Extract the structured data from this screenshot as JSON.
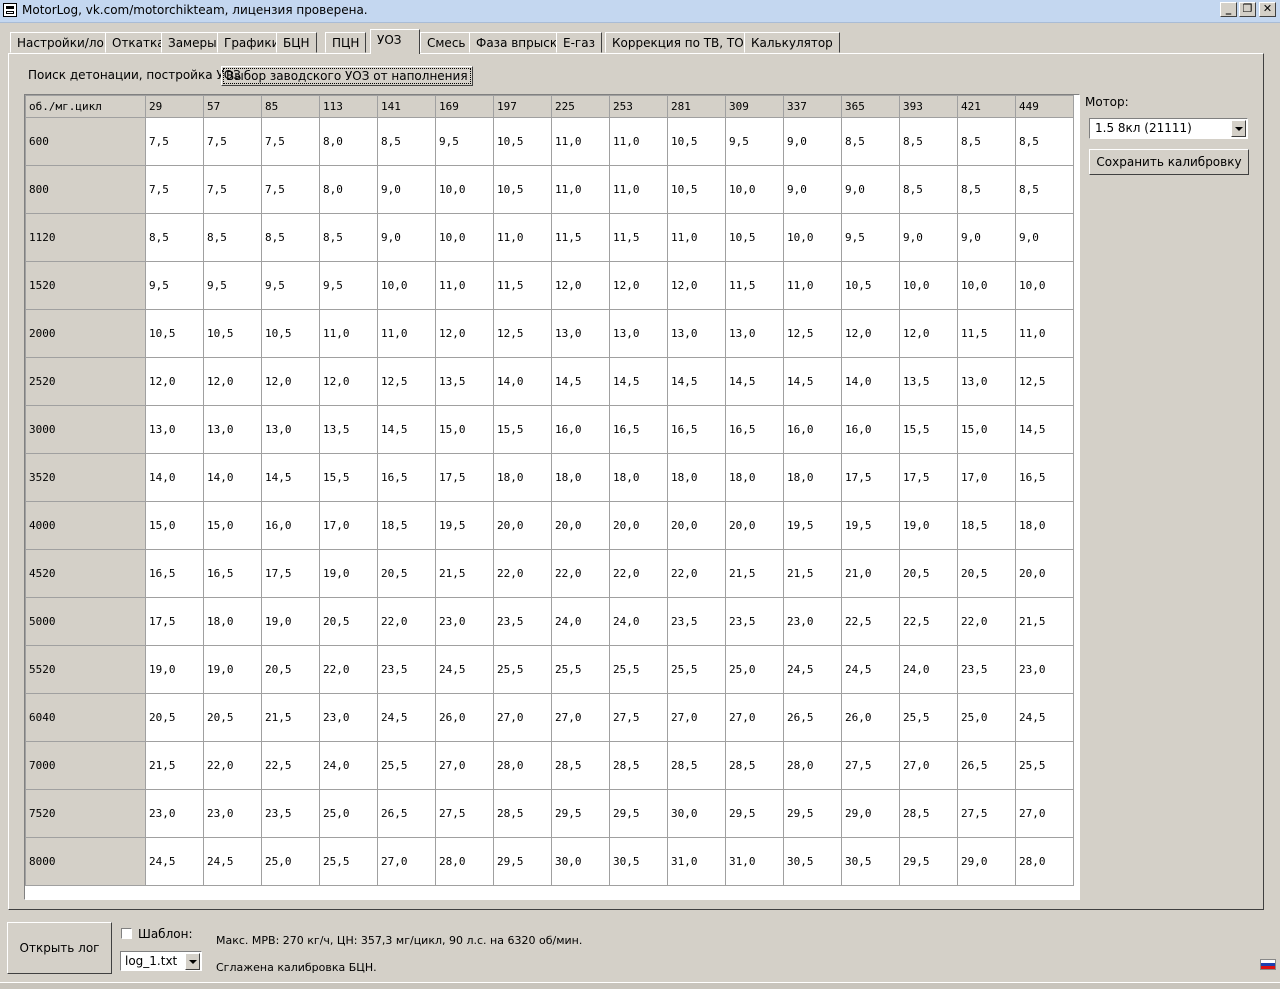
{
  "window": {
    "title": "MotorLog, vk.com/motorchikteam, лицензия проверена."
  },
  "tabs": [
    {
      "label": "Настройки/лог"
    },
    {
      "label": "Откатка"
    },
    {
      "label": "Замеры"
    },
    {
      "label": "Графики"
    },
    {
      "label": "БЦН"
    },
    {
      "label": "ПЦН"
    },
    {
      "label": "УОЗ"
    },
    {
      "label": "Смесь"
    },
    {
      "label": "Фаза впрыска"
    },
    {
      "label": "E-газ"
    },
    {
      "label": "Коррекция по ТВ, ТОЖ"
    },
    {
      "label": "Калькулятор"
    }
  ],
  "active_tab": "УОЗ",
  "subtabs": [
    {
      "label": "Поиск детонации, постройка УОЗ"
    },
    {
      "label": "Выбор заводского УОЗ от наполнения"
    }
  ],
  "active_subtab": "Выбор заводского УОЗ от наполнения",
  "grid": {
    "corner": "об./мг.цикл",
    "columns": [
      "29",
      "57",
      "85",
      "113",
      "141",
      "169",
      "197",
      "225",
      "253",
      "281",
      "309",
      "337",
      "365",
      "393",
      "421",
      "449"
    ],
    "rows": [
      {
        "rpm": "600",
        "values": [
          "7,5",
          "7,5",
          "7,5",
          "8,0",
          "8,5",
          "9,5",
          "10,5",
          "11,0",
          "11,0",
          "10,5",
          "9,5",
          "9,0",
          "8,5",
          "8,5",
          "8,5",
          "8,5"
        ]
      },
      {
        "rpm": "800",
        "values": [
          "7,5",
          "7,5",
          "7,5",
          "8,0",
          "9,0",
          "10,0",
          "10,5",
          "11,0",
          "11,0",
          "10,5",
          "10,0",
          "9,0",
          "9,0",
          "8,5",
          "8,5",
          "8,5"
        ]
      },
      {
        "rpm": "1120",
        "values": [
          "8,5",
          "8,5",
          "8,5",
          "8,5",
          "9,0",
          "10,0",
          "11,0",
          "11,5",
          "11,5",
          "11,0",
          "10,5",
          "10,0",
          "9,5",
          "9,0",
          "9,0",
          "9,0"
        ]
      },
      {
        "rpm": "1520",
        "values": [
          "9,5",
          "9,5",
          "9,5",
          "9,5",
          "10,0",
          "11,0",
          "11,5",
          "12,0",
          "12,0",
          "12,0",
          "11,5",
          "11,0",
          "10,5",
          "10,0",
          "10,0",
          "10,0"
        ]
      },
      {
        "rpm": "2000",
        "values": [
          "10,5",
          "10,5",
          "10,5",
          "11,0",
          "11,0",
          "12,0",
          "12,5",
          "13,0",
          "13,0",
          "13,0",
          "13,0",
          "12,5",
          "12,0",
          "12,0",
          "11,5",
          "11,0"
        ]
      },
      {
        "rpm": "2520",
        "values": [
          "12,0",
          "12,0",
          "12,0",
          "12,0",
          "12,5",
          "13,5",
          "14,0",
          "14,5",
          "14,5",
          "14,5",
          "14,5",
          "14,5",
          "14,0",
          "13,5",
          "13,0",
          "12,5"
        ]
      },
      {
        "rpm": "3000",
        "values": [
          "13,0",
          "13,0",
          "13,0",
          "13,5",
          "14,5",
          "15,0",
          "15,5",
          "16,0",
          "16,5",
          "16,5",
          "16,5",
          "16,0",
          "16,0",
          "15,5",
          "15,0",
          "14,5"
        ]
      },
      {
        "rpm": "3520",
        "values": [
          "14,0",
          "14,0",
          "14,5",
          "15,5",
          "16,5",
          "17,5",
          "18,0",
          "18,0",
          "18,0",
          "18,0",
          "18,0",
          "18,0",
          "17,5",
          "17,5",
          "17,0",
          "16,5"
        ]
      },
      {
        "rpm": "4000",
        "values": [
          "15,0",
          "15,0",
          "16,0",
          "17,0",
          "18,5",
          "19,5",
          "20,0",
          "20,0",
          "20,0",
          "20,0",
          "20,0",
          "19,5",
          "19,5",
          "19,0",
          "18,5",
          "18,0"
        ]
      },
      {
        "rpm": "4520",
        "values": [
          "16,5",
          "16,5",
          "17,5",
          "19,0",
          "20,5",
          "21,5",
          "22,0",
          "22,0",
          "22,0",
          "22,0",
          "21,5",
          "21,5",
          "21,0",
          "20,5",
          "20,5",
          "20,0"
        ]
      },
      {
        "rpm": "5000",
        "values": [
          "17,5",
          "18,0",
          "19,0",
          "20,5",
          "22,0",
          "23,0",
          "23,5",
          "24,0",
          "24,0",
          "23,5",
          "23,5",
          "23,0",
          "22,5",
          "22,5",
          "22,0",
          "21,5"
        ]
      },
      {
        "rpm": "5520",
        "values": [
          "19,0",
          "19,0",
          "20,5",
          "22,0",
          "23,5",
          "24,5",
          "25,5",
          "25,5",
          "25,5",
          "25,5",
          "25,0",
          "24,5",
          "24,5",
          "24,0",
          "23,5",
          "23,0"
        ]
      },
      {
        "rpm": "6040",
        "values": [
          "20,5",
          "20,5",
          "21,5",
          "23,0",
          "24,5",
          "26,0",
          "27,0",
          "27,0",
          "27,5",
          "27,0",
          "27,0",
          "26,5",
          "26,0",
          "25,5",
          "25,0",
          "24,5"
        ]
      },
      {
        "rpm": "7000",
        "values": [
          "21,5",
          "22,0",
          "22,5",
          "24,0",
          "25,5",
          "27,0",
          "28,0",
          "28,5",
          "28,5",
          "28,5",
          "28,5",
          "28,0",
          "27,5",
          "27,0",
          "26,5",
          "25,5"
        ]
      },
      {
        "rpm": "7520",
        "values": [
          "23,0",
          "23,0",
          "23,5",
          "25,0",
          "26,5",
          "27,5",
          "28,5",
          "29,5",
          "29,5",
          "30,0",
          "29,5",
          "29,5",
          "29,0",
          "28,5",
          "27,5",
          "27,0"
        ]
      },
      {
        "rpm": "8000",
        "values": [
          "24,5",
          "24,5",
          "25,0",
          "25,5",
          "27,0",
          "28,0",
          "29,5",
          "30,0",
          "30,5",
          "31,0",
          "31,0",
          "30,5",
          "30,5",
          "29,5",
          "29,0",
          "28,0"
        ]
      }
    ]
  },
  "side": {
    "motor_label": "Мотор:",
    "motor_value": "1.5 8кл (21111)",
    "save_label": "Сохранить калибровку"
  },
  "bottom": {
    "open_log_label": "Открыть лог",
    "template_label": "Шаблон:",
    "template_checked": false,
    "log_file": "log_1.txt",
    "status_line1": "Макс. МРВ: 270 кг/ч, ЦН: 357,3 мг/цикл, 90 л.с. на 6320 об/мин.",
    "status_line2": "Сглажена калибровка БЦН."
  }
}
